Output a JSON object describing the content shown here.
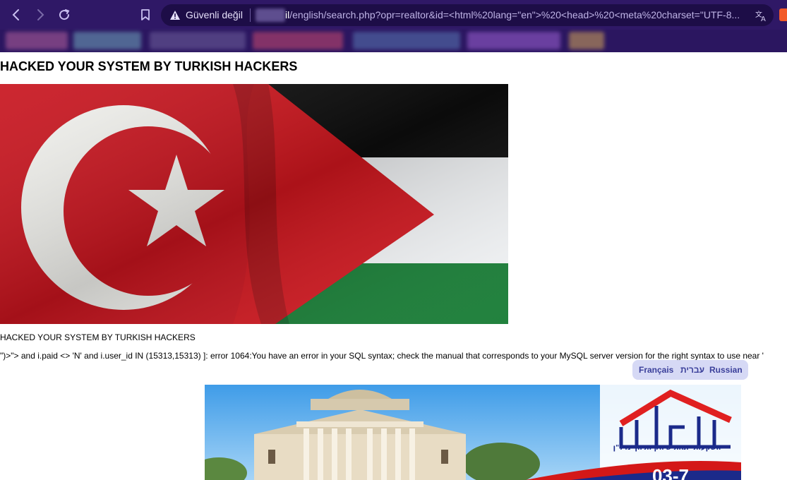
{
  "browser": {
    "security_label": "Güvenli değil",
    "url_host_suffix": "il",
    "url_rest": "/english/search.php?opr=realtor&id=<html%20lang=\"en\">%20<head>%20<meta%20charset=\"UTF-8...",
    "icons": {
      "back": "arrow-left-icon",
      "forward": "arrow-right-icon",
      "reload": "reload-icon",
      "bookmark": "bookmark-icon",
      "warning": "warning-triangle-icon",
      "translate": "translate-icon",
      "brave": "brave-shield-icon"
    },
    "theme_color": "#2f1866"
  },
  "page": {
    "heading": "HACKED YOUR SYSTEM BY TURKISH HACKERS",
    "caption": "HACKED YOUR SYSTEM BY TURKISH HACKERS",
    "sql_error": "\")>\"> and i.paid <> 'N' and i.user_id IN (15313,15313) ]: error 1064:You have an error in your SQL syntax; check the manual that corresponds to your MySQL server version for the right syntax to use near '",
    "languages": [
      "Français",
      "עברית",
      "Russian"
    ],
    "banner_logo_text": "השקעות יזמות שיווק ותיווך נדל\"ן"
  }
}
